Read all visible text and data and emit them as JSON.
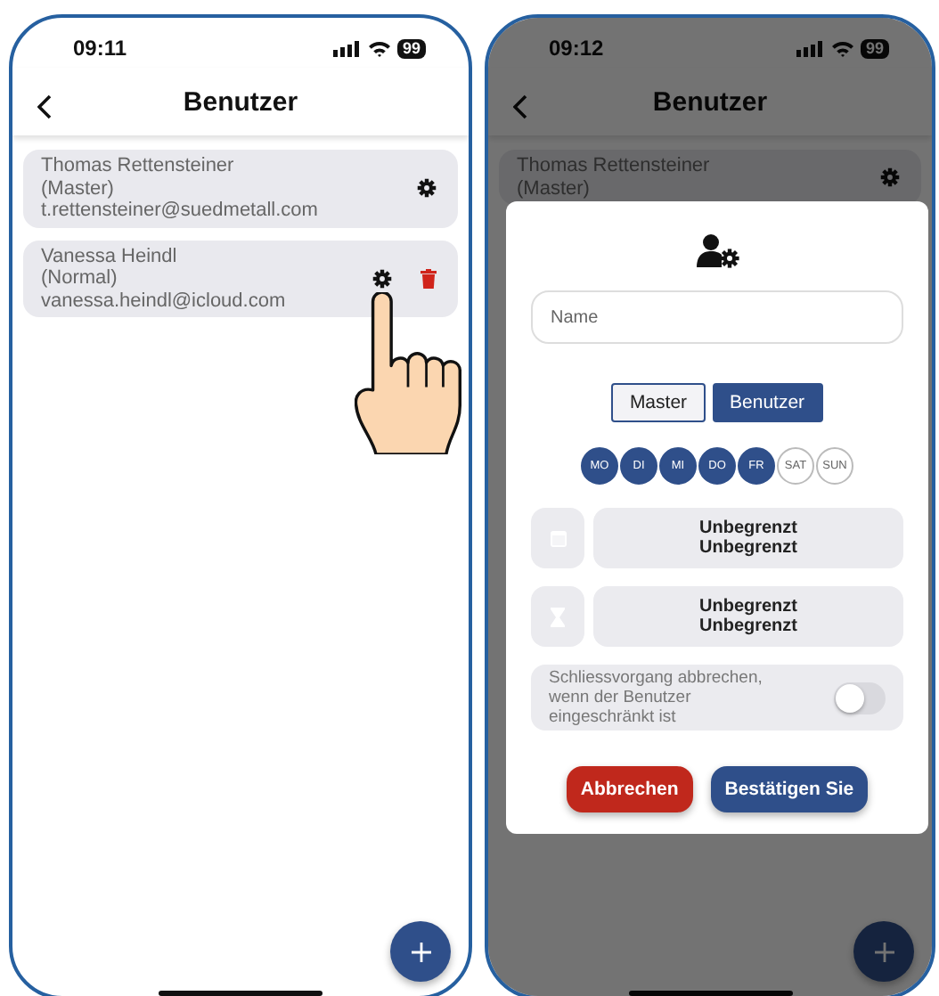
{
  "screens": [
    {
      "status_bar": {
        "time": "09:11",
        "battery": "99"
      },
      "header": {
        "title": "Benutzer"
      },
      "touch_hint": true,
      "users": [
        {
          "name": "Thomas Rettensteiner",
          "role": "(Master)",
          "email": "t.rettensteiner@suedmetall.com",
          "deletable": false
        },
        {
          "name": "Vanessa Heindl",
          "role": "(Normal)",
          "email": "vanessa.heindl@icloud.com",
          "deletable": true
        }
      ]
    },
    {
      "status_bar": {
        "time": "09:12",
        "battery": "99"
      },
      "header": {
        "title": "Benutzer"
      },
      "touch_hint": false,
      "users": [
        {
          "name": "Thomas Rettensteiner",
          "role": "(Master)",
          "deletable": false
        }
      ],
      "dialog": {
        "name_field": {
          "placeholder": "Name"
        },
        "roles": [
          {
            "label": "Master",
            "selected": false
          },
          {
            "label": "Benutzer",
            "selected": true
          }
        ],
        "days": [
          {
            "label": "MO",
            "selected": true
          },
          {
            "label": "DI",
            "selected": true
          },
          {
            "label": "MI",
            "selected": true
          },
          {
            "label": "DO",
            "selected": true
          },
          {
            "label": "FR",
            "selected": true
          },
          {
            "label": "SAT",
            "selected": false
          },
          {
            "label": "SUN",
            "selected": false
          }
        ],
        "limits": [
          {
            "kind": "date",
            "lines": [
              "Unbegrenzt",
              "Unbegrenzt"
            ]
          },
          {
            "kind": "time",
            "lines": [
              "Unbegrenzt",
              "Unbegrenzt"
            ]
          }
        ],
        "toggle": {
          "label": "Schliessvorgang abbrechen, wenn der Benutzer eingeschränkt ist",
          "on": false
        },
        "buttons": [
          {
            "label": "Abbrechen",
            "kind": "cancel"
          },
          {
            "label": "Bestätigen Sie",
            "kind": "confirm"
          }
        ]
      }
    }
  ]
}
